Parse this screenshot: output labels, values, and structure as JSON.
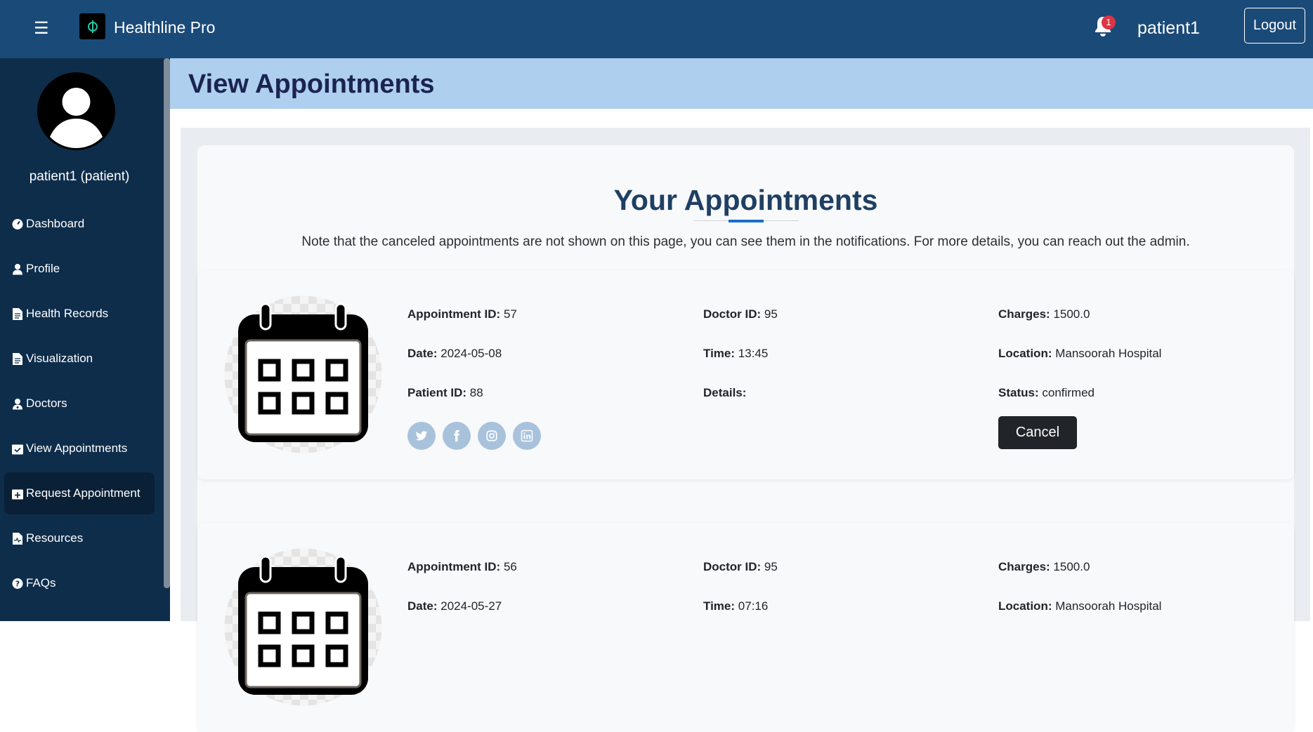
{
  "navbar": {
    "brand": "Healthline Pro",
    "notification_count": "1",
    "username": "patient1",
    "logout_label": "Logout"
  },
  "sidebar": {
    "user_label": "patient1 (patient)",
    "items": [
      {
        "label": "Dashboard",
        "icon": "dashboard-icon"
      },
      {
        "label": "Profile",
        "icon": "user-icon"
      },
      {
        "label": "Health Records",
        "icon": "file-icon"
      },
      {
        "label": "Visualization",
        "icon": "file-icon"
      },
      {
        "label": "Doctors",
        "icon": "doctor-icon"
      },
      {
        "label": "View Appointments",
        "icon": "calendar-check-icon"
      },
      {
        "label": "Request Appointment",
        "icon": "calendar-plus-icon",
        "active": true
      },
      {
        "label": "Resources",
        "icon": "file-medical-icon"
      },
      {
        "label": "FAQs",
        "icon": "question-circle-icon"
      }
    ]
  },
  "page": {
    "title": "View Appointments",
    "section_title": "Your Appointments",
    "note": "Note that the canceled appointments are not shown on this page, you can see them in the notifications. For more details, you can reach out the admin."
  },
  "labels": {
    "appointment_id": "Appointment ID:",
    "doctor_id": "Doctor ID:",
    "charges": "Charges:",
    "date": "Date:",
    "time": "Time:",
    "location": "Location:",
    "patient_id": "Patient ID:",
    "details": "Details:",
    "status": "Status:",
    "cancel": "Cancel"
  },
  "appointments": [
    {
      "appointment_id": "57",
      "doctor_id": "95",
      "charges": "1500.0",
      "date": "2024-05-08",
      "time": "13:45",
      "location": "Mansoorah Hospital",
      "patient_id": "88",
      "details": "",
      "status": "confirmed"
    },
    {
      "appointment_id": "56",
      "doctor_id": "95",
      "charges": "1500.0",
      "date": "2024-05-27",
      "time": "07:16",
      "location": "Mansoorah Hospital"
    }
  ],
  "colors": {
    "navbar": "#1a4a78",
    "sidebar": "#0e2d4b",
    "header": "#aecfee",
    "accent": "#1a6fc9"
  }
}
